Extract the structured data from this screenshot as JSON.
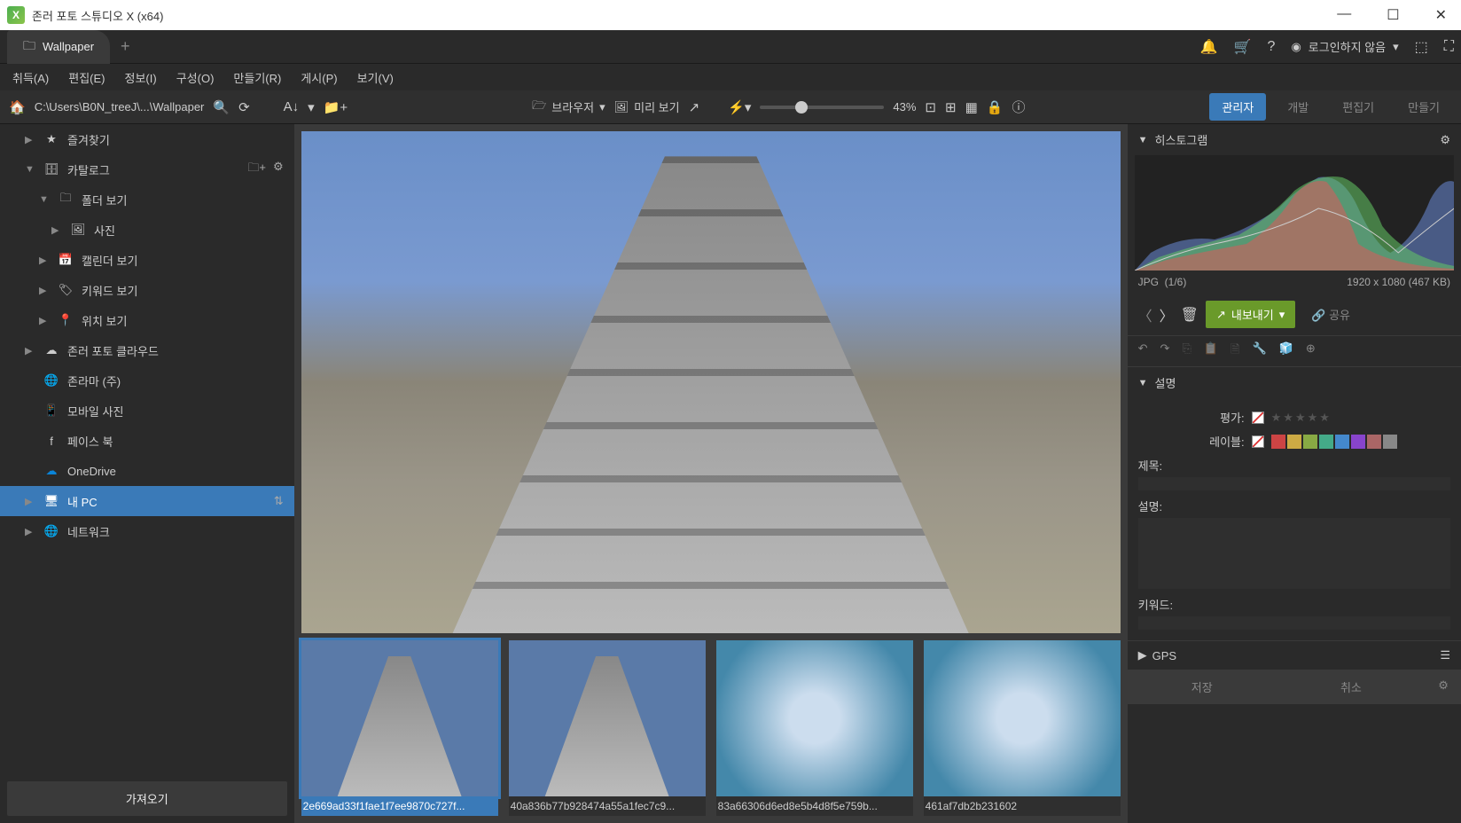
{
  "window": {
    "title": "존러 포토 스튜디오 X (x64)"
  },
  "tab": {
    "name": "Wallpaper"
  },
  "topbar": {
    "login_text": "로그인하지 않음"
  },
  "menu": {
    "items": [
      "취득(A)",
      "편집(E)",
      "정보(I)",
      "구성(O)",
      "만들기(R)",
      "게시(P)",
      "보기(V)"
    ]
  },
  "toolbar": {
    "path": "C:\\Users\\B0N_treeJ\\...\\Wallpaper",
    "browser": "브라우저",
    "preview": "미리 보기",
    "zoom": "43%",
    "modes": {
      "manager": "관리자",
      "develop": "개발",
      "editor": "편집기",
      "create": "만들기"
    }
  },
  "sidebar": {
    "favorites": "즐겨찾기",
    "catalog": "카탈로그",
    "folder_view": "폴더 보기",
    "photos": "사진",
    "calendar": "캘린더 보기",
    "keywords": "키워드 보기",
    "locations": "위치 보기",
    "zoner_cloud": "존러 포토 클라우드",
    "zonerama": "존라마 (주)",
    "mobile": "모바일 사진",
    "facebook": "페이스 북",
    "onedrive": "OneDrive",
    "my_pc": "내 PC",
    "network": "네트워크",
    "import": "가져오기"
  },
  "thumbs": [
    {
      "name": "2e669ad33f1fae1f7ee9870c727f...",
      "selected": true,
      "type": "tower"
    },
    {
      "name": "40a836b77b928474a55a1fec7c9...",
      "selected": false,
      "type": "tower"
    },
    {
      "name": "83a66306d6ed8e5b4d8f5e759b...",
      "selected": false,
      "type": "ice"
    },
    {
      "name": "461af7db2b231602",
      "selected": false,
      "type": "ice"
    }
  ],
  "rightpanel": {
    "histogram_title": "히스토그램",
    "format": "JPG",
    "position": "(1/6)",
    "dimensions": "1920 x 1080 (467 KB)",
    "export": "내보내기",
    "share": "공유",
    "description_title": "설명",
    "rating_label": "평가:",
    "label_label": "레이블:",
    "title_label": "제목:",
    "desc_label": "설명:",
    "keywords_label": "키워드:",
    "gps": "GPS",
    "save": "저장",
    "cancel": "취소",
    "label_colors": [
      "#c44",
      "#ca4",
      "#8a4",
      "#4a8",
      "#48c",
      "#84c",
      "#a66",
      "#888"
    ]
  }
}
